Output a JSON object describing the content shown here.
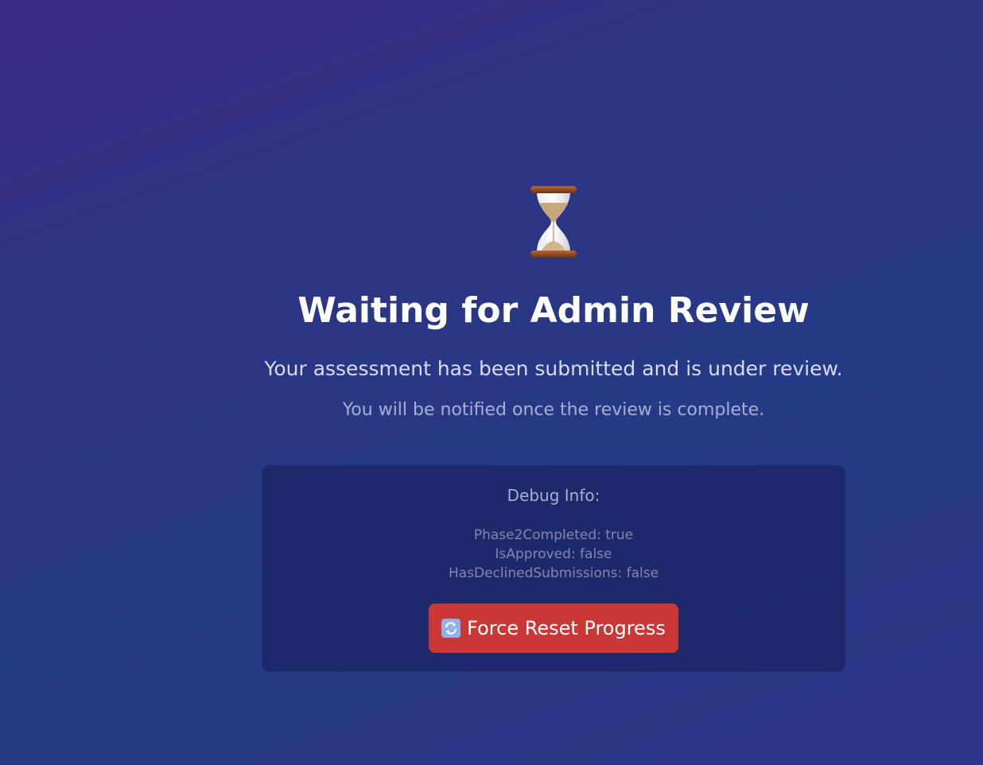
{
  "status": {
    "icon": "hourglass-icon",
    "title": "Waiting for Admin Review",
    "subtitle": "Your assessment has been submitted and is under review.",
    "note": "You will be notified once the review is complete."
  },
  "debug": {
    "title": "Debug Info:",
    "lines": [
      "Phase2Completed: true",
      "IsApproved: false",
      "HasDeclinedSubmissions: false"
    ]
  },
  "reset_button": {
    "icon": "refresh-icon",
    "label": "Force Reset Progress"
  },
  "colors": {
    "background": "#2e3483",
    "button": "#c93837",
    "title": "#ffffff"
  }
}
